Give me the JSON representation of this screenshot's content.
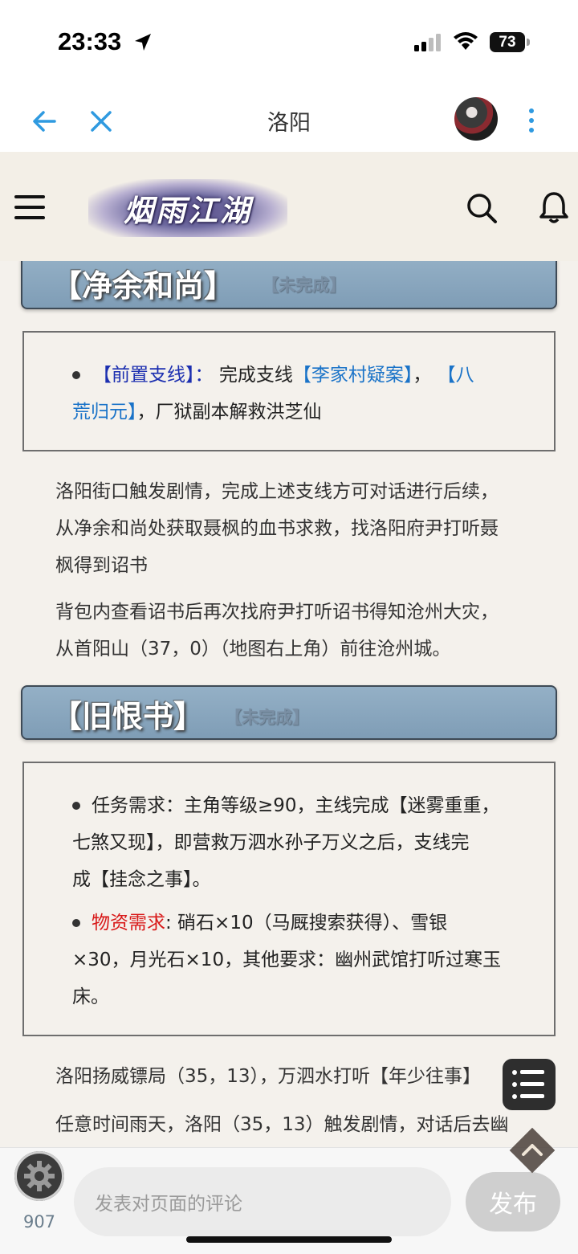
{
  "status_bar": {
    "time": "23:33",
    "battery": "73"
  },
  "browser": {
    "title": "洛阳"
  },
  "site": {
    "logo_text": "烟雨江湖"
  },
  "sections": [
    {
      "title": "【净余和尚】",
      "status": "【未完成】",
      "bullets": [
        {
          "label": "【前置支线】：",
          "text_plain_1": "完成支线",
          "link_1": "【李家村疑案】",
          "sep": "，",
          "link_2_line1": "【八",
          "link_2_line2": "荒归元】",
          "text_plain_2": "，厂狱副本解救洪芝仙"
        }
      ],
      "paragraphs": [
        {
          "lines": [
            "洛阳街口触发剧情，完成上述支线方可对话进行后续，",
            "从净余和尚处获取聂枫的血书求救，找洛阳府尹打听聂",
            "枫得到诏书"
          ]
        },
        {
          "lines": [
            "背包内查看诏书后再次找府尹打听诏书得知沧州大灾，",
            "从首阳山（37，0）（地图右上角）前往沧州城。"
          ]
        }
      ]
    },
    {
      "title": "【旧恨书】",
      "status": "【未完成】",
      "bullets": [
        {
          "lines": [
            "任务需求：主角等级≥90，主线完成【迷雾重重，",
            "七煞又现】，即营救万泗水孙子万义之后，支线完",
            "成【挂念之事】。"
          ]
        },
        {
          "label": "物资需求",
          "line1_rest": ": 硝石×10（马厩搜索获得）、雪银",
          "line2": "×30，月光石×10，其他要求：幽州武馆打听过寒玉",
          "line3": "床。"
        }
      ],
      "paragraphs": [
        {
          "lines": [
            "洛阳扬威镖局（35，13），万泗水打听【年少往事】"
          ]
        },
        {
          "lines": [
            "任意时间雨天，洛阳（35，13）触发剧情，对话后去幽"
          ]
        }
      ]
    }
  ],
  "bottom_bar": {
    "comment_count": "907",
    "comment_placeholder": "发表对页面的评论",
    "publish_label": "发布"
  },
  "icons": {
    "back": "arrow-left-icon",
    "close": "close-icon",
    "more": "more-vertical-icon",
    "menu": "hamburger-icon",
    "search": "search-icon",
    "notifications": "bell-icon",
    "settings": "gear-icon",
    "list": "list-icon",
    "scroll_top": "chevron-up-icon"
  },
  "colors": {
    "accent_blue": "#1a73c8",
    "section_header": "#8aa7be",
    "material_red": "#d81818",
    "background": "#f4f1ec"
  }
}
